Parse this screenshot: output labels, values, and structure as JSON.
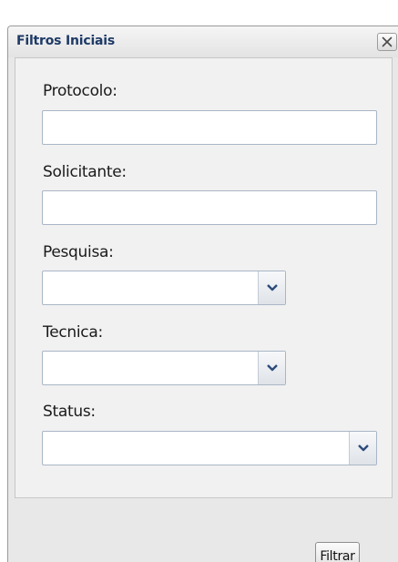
{
  "dialog": {
    "title": "Filtros Iniciais",
    "close_icon": "close-icon"
  },
  "fields": {
    "protocolo": {
      "label": "Protocolo:",
      "value": ""
    },
    "solicitante": {
      "label": "Solicitante:",
      "value": ""
    },
    "pesquisa": {
      "label": "Pesquisa:",
      "selected": ""
    },
    "tecnica": {
      "label": "Tecnica:",
      "selected": ""
    },
    "status": {
      "label": "Status:",
      "selected": ""
    }
  },
  "actions": {
    "filter_label": "Filtrar"
  },
  "colors": {
    "title_text": "#1e3a66",
    "window_bg": "#e8e8e8",
    "panel_bg": "#f1f1f1",
    "input_border": "#a9b6c6",
    "dropdown_arrow": "#2c4c7c"
  }
}
